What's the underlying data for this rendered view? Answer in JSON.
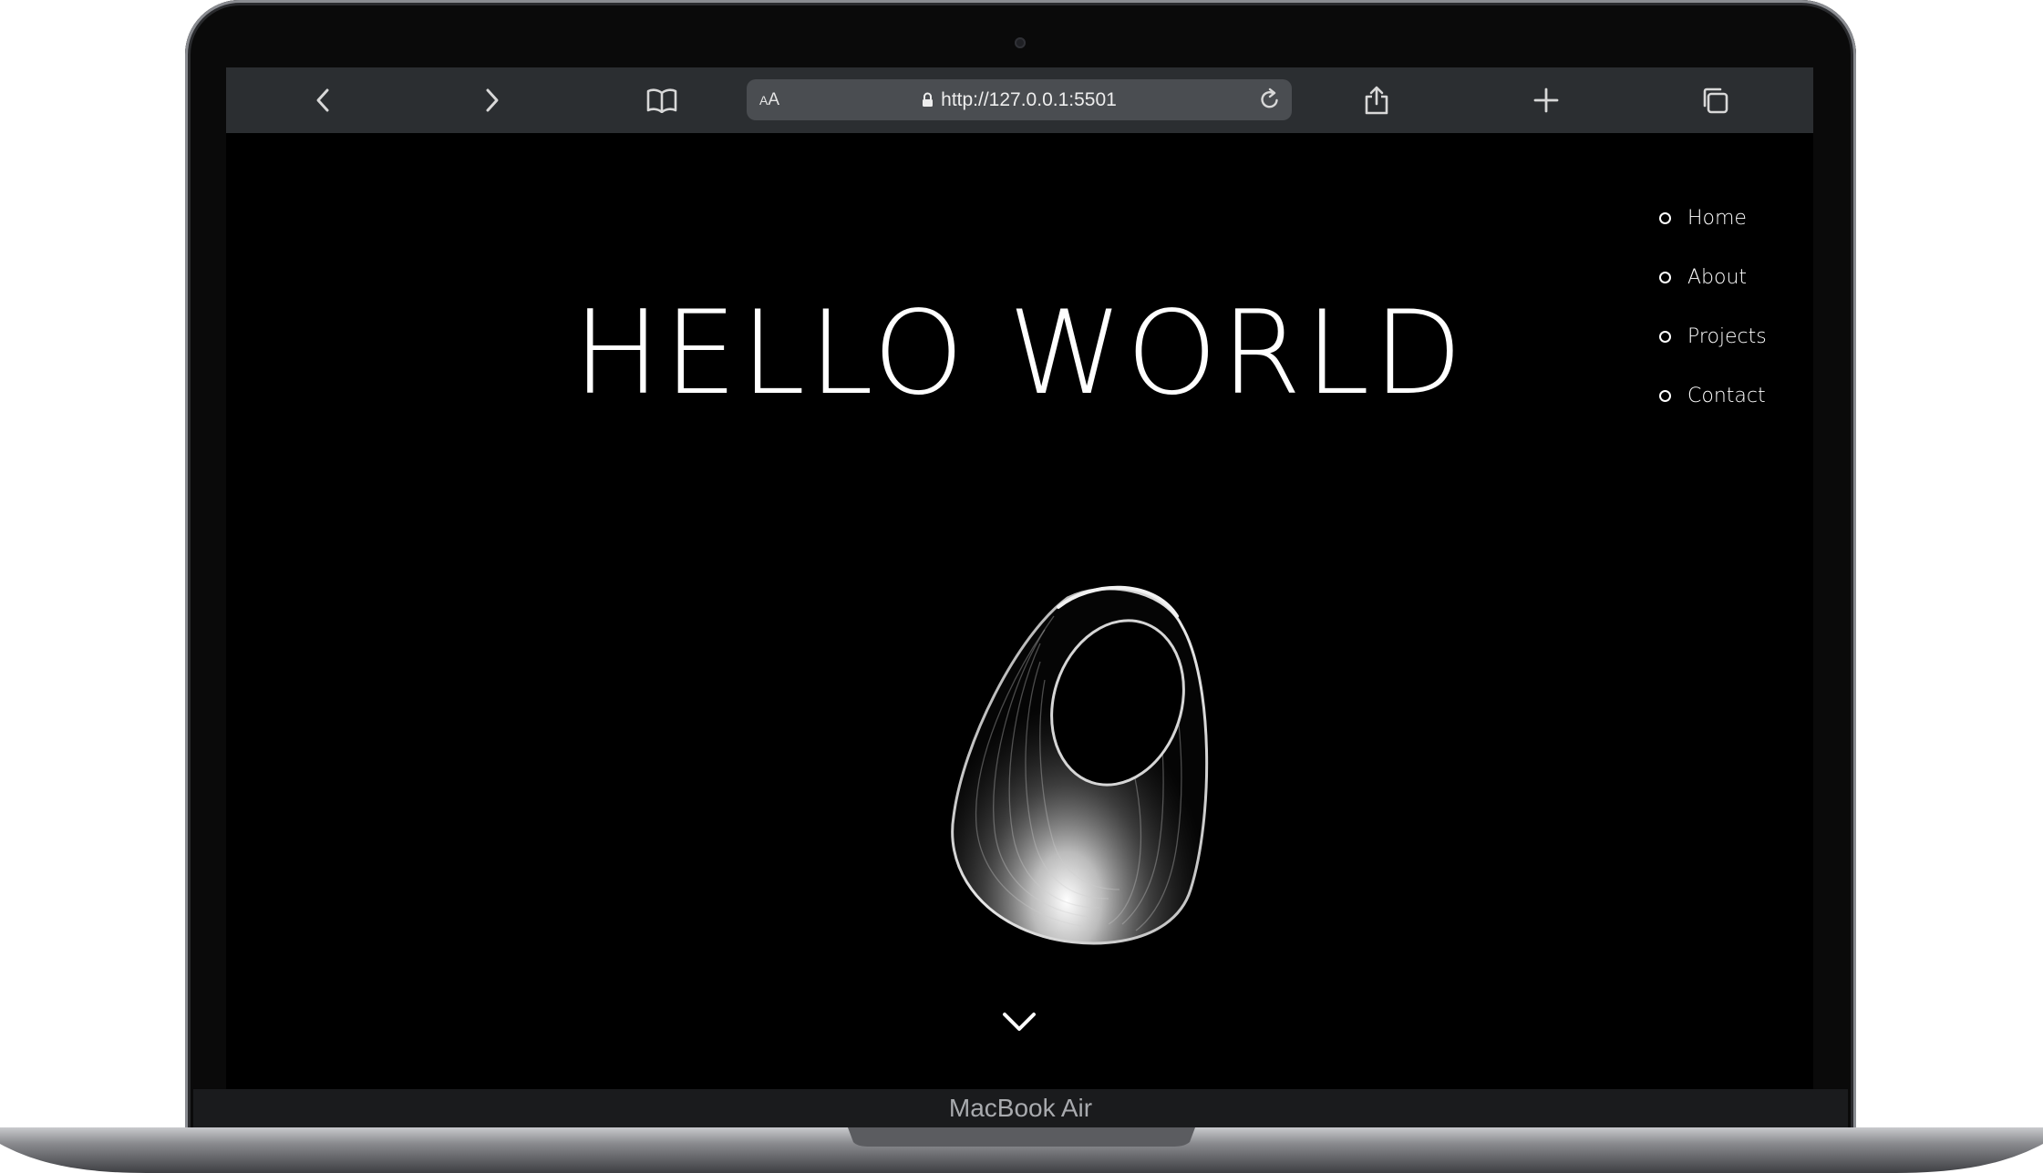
{
  "browser": {
    "reader_label_small": "A",
    "reader_label_large": "A",
    "url": "http://127.0.0.1:5501",
    "icons": [
      "back-icon",
      "forward-icon",
      "bookmarks-icon",
      "lock-icon",
      "reload-icon",
      "share-icon",
      "new-tab-icon",
      "tabs-icon"
    ]
  },
  "page": {
    "title": "HELLO WORLD",
    "nav": [
      {
        "label": "Home"
      },
      {
        "label": "About"
      },
      {
        "label": "Projects"
      },
      {
        "label": "Contact"
      }
    ],
    "scroll_icon": "chevron-down-icon"
  },
  "device": {
    "label": "MacBook Air"
  },
  "colors": {
    "page_bg": "#000000",
    "text": "#ffffff",
    "toolbar_bg": "#2b2e31",
    "urlbar_bg": "#4a4d51"
  }
}
